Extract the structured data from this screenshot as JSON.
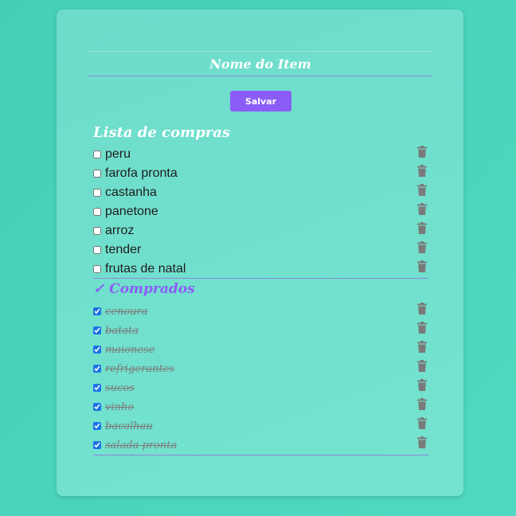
{
  "form": {
    "placeholder": "Nome do Item",
    "save_label": "Salvar"
  },
  "shopping": {
    "title": "Lista de compras",
    "items": [
      "peru",
      "farofa pronta",
      "castanha",
      "panetone",
      "arroz",
      "tender",
      "frutas de natal"
    ]
  },
  "purchased": {
    "check_mark": "✓",
    "title": "Comprados",
    "items": [
      "cenoura",
      "batata",
      "maionese",
      "refrigerantes",
      "sucos",
      "vinho",
      "bacalhau",
      "salada pronta"
    ]
  },
  "icons": {
    "delete": "trash-icon"
  },
  "colors": {
    "accent": "#8b5cf6",
    "icon": "#7a7a7a",
    "divider": "#8f87d9",
    "checkbox": "#1a73e8"
  }
}
